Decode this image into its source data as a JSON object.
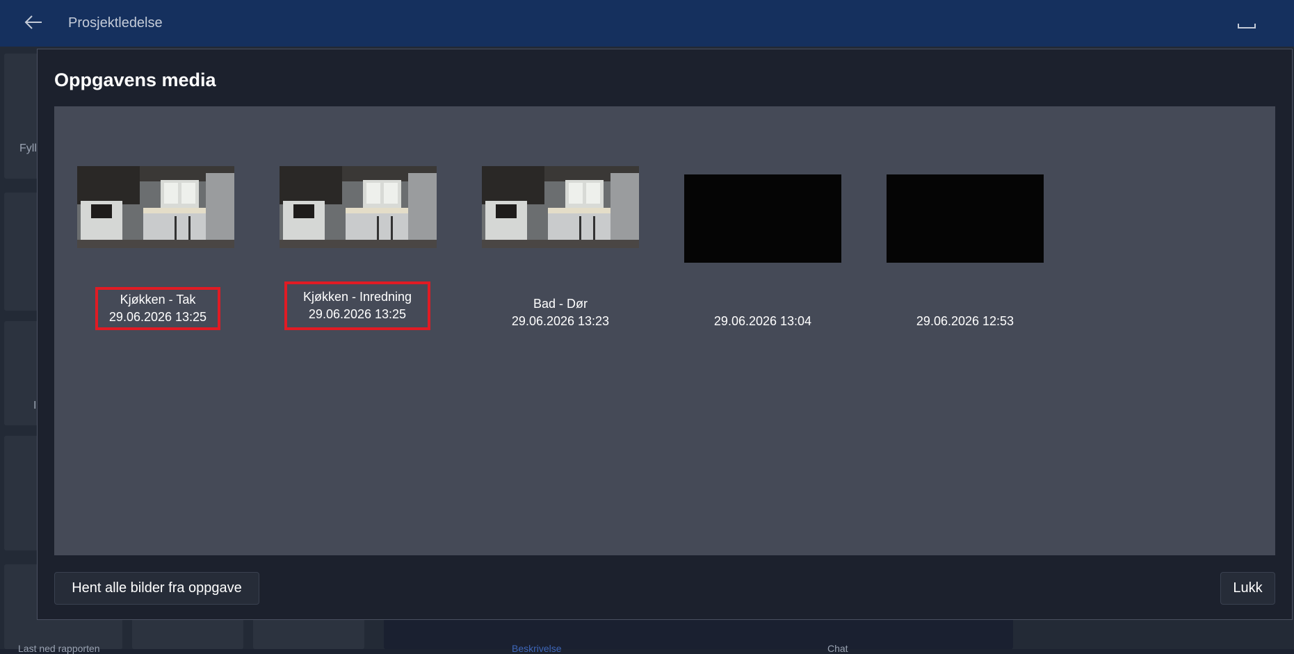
{
  "app": {
    "title": "Prosjektledelse"
  },
  "background": {
    "side_label_1": "Fyll",
    "side_label_2": "I",
    "bottom_label": "Last ned rapporten",
    "tab_1": "Beskrivelse",
    "tab_2": "Chat"
  },
  "modal": {
    "title": "Oppgavens media",
    "items": [
      {
        "name": "Kjøkken - Tak",
        "date": "29.06.2026 13:25",
        "thumbnail": "kitchen-photo",
        "highlighted": true
      },
      {
        "name": "Kjøkken - Inredning",
        "date": "29.06.2026 13:25",
        "thumbnail": "kitchen-photo",
        "highlighted": true
      },
      {
        "name": "Bad - Dør",
        "date": "29.06.2026 13:23",
        "thumbnail": "kitchen-photo",
        "highlighted": false
      },
      {
        "name": "",
        "date": "29.06.2026 13:04",
        "thumbnail": "black",
        "highlighted": false
      },
      {
        "name": "",
        "date": "29.06.2026 12:53",
        "thumbnail": "black",
        "highlighted": false
      }
    ],
    "fetch_all_label": "Hent alle bilder fra oppgave",
    "close_label": "Lukk"
  },
  "colors": {
    "header": "#15305e",
    "modal_bg": "#1c212d",
    "panel_bg": "#454a57",
    "highlight": "#e01b24"
  }
}
